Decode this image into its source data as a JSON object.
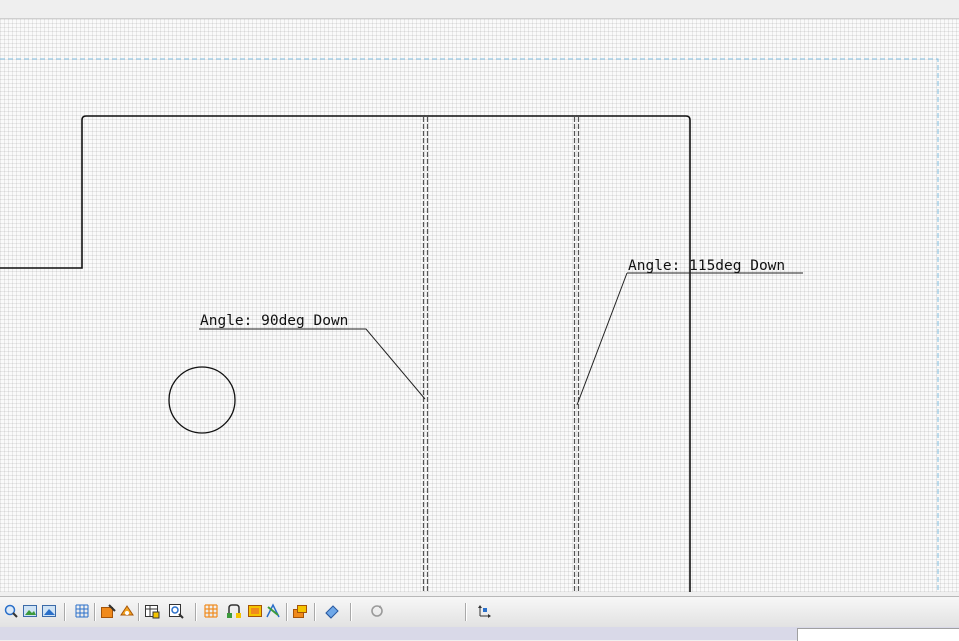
{
  "drawing": {
    "annotations": [
      {
        "text": "Angle: 90deg Down"
      },
      {
        "text": "Angle: 115deg Down"
      }
    ]
  },
  "toolbar": {
    "buttons": [
      {
        "icon": "zoom-icon"
      },
      {
        "icon": "view-image-icon"
      },
      {
        "icon": "view-image-2-icon"
      },
      {
        "icon": "grid-icon"
      },
      {
        "icon": "sketch-icon"
      },
      {
        "icon": "snap-icon"
      },
      {
        "icon": "table-icon"
      },
      {
        "icon": "zoom-window-icon"
      },
      {
        "icon": "grid-orange-icon"
      },
      {
        "icon": "constraint-icon"
      },
      {
        "icon": "image-frame-icon"
      },
      {
        "icon": "analysis-icon"
      },
      {
        "icon": "layers-icon"
      },
      {
        "icon": "eraser-icon"
      },
      {
        "icon": "refresh-icon"
      },
      {
        "icon": "axis-icon"
      }
    ]
  },
  "colors": {
    "sheet_border": "#7fbde0",
    "outline": "#111111",
    "bend_line": "#555555",
    "toolbar_orange": "#f08a1c",
    "toolbar_blue": "#2a6fc9"
  }
}
